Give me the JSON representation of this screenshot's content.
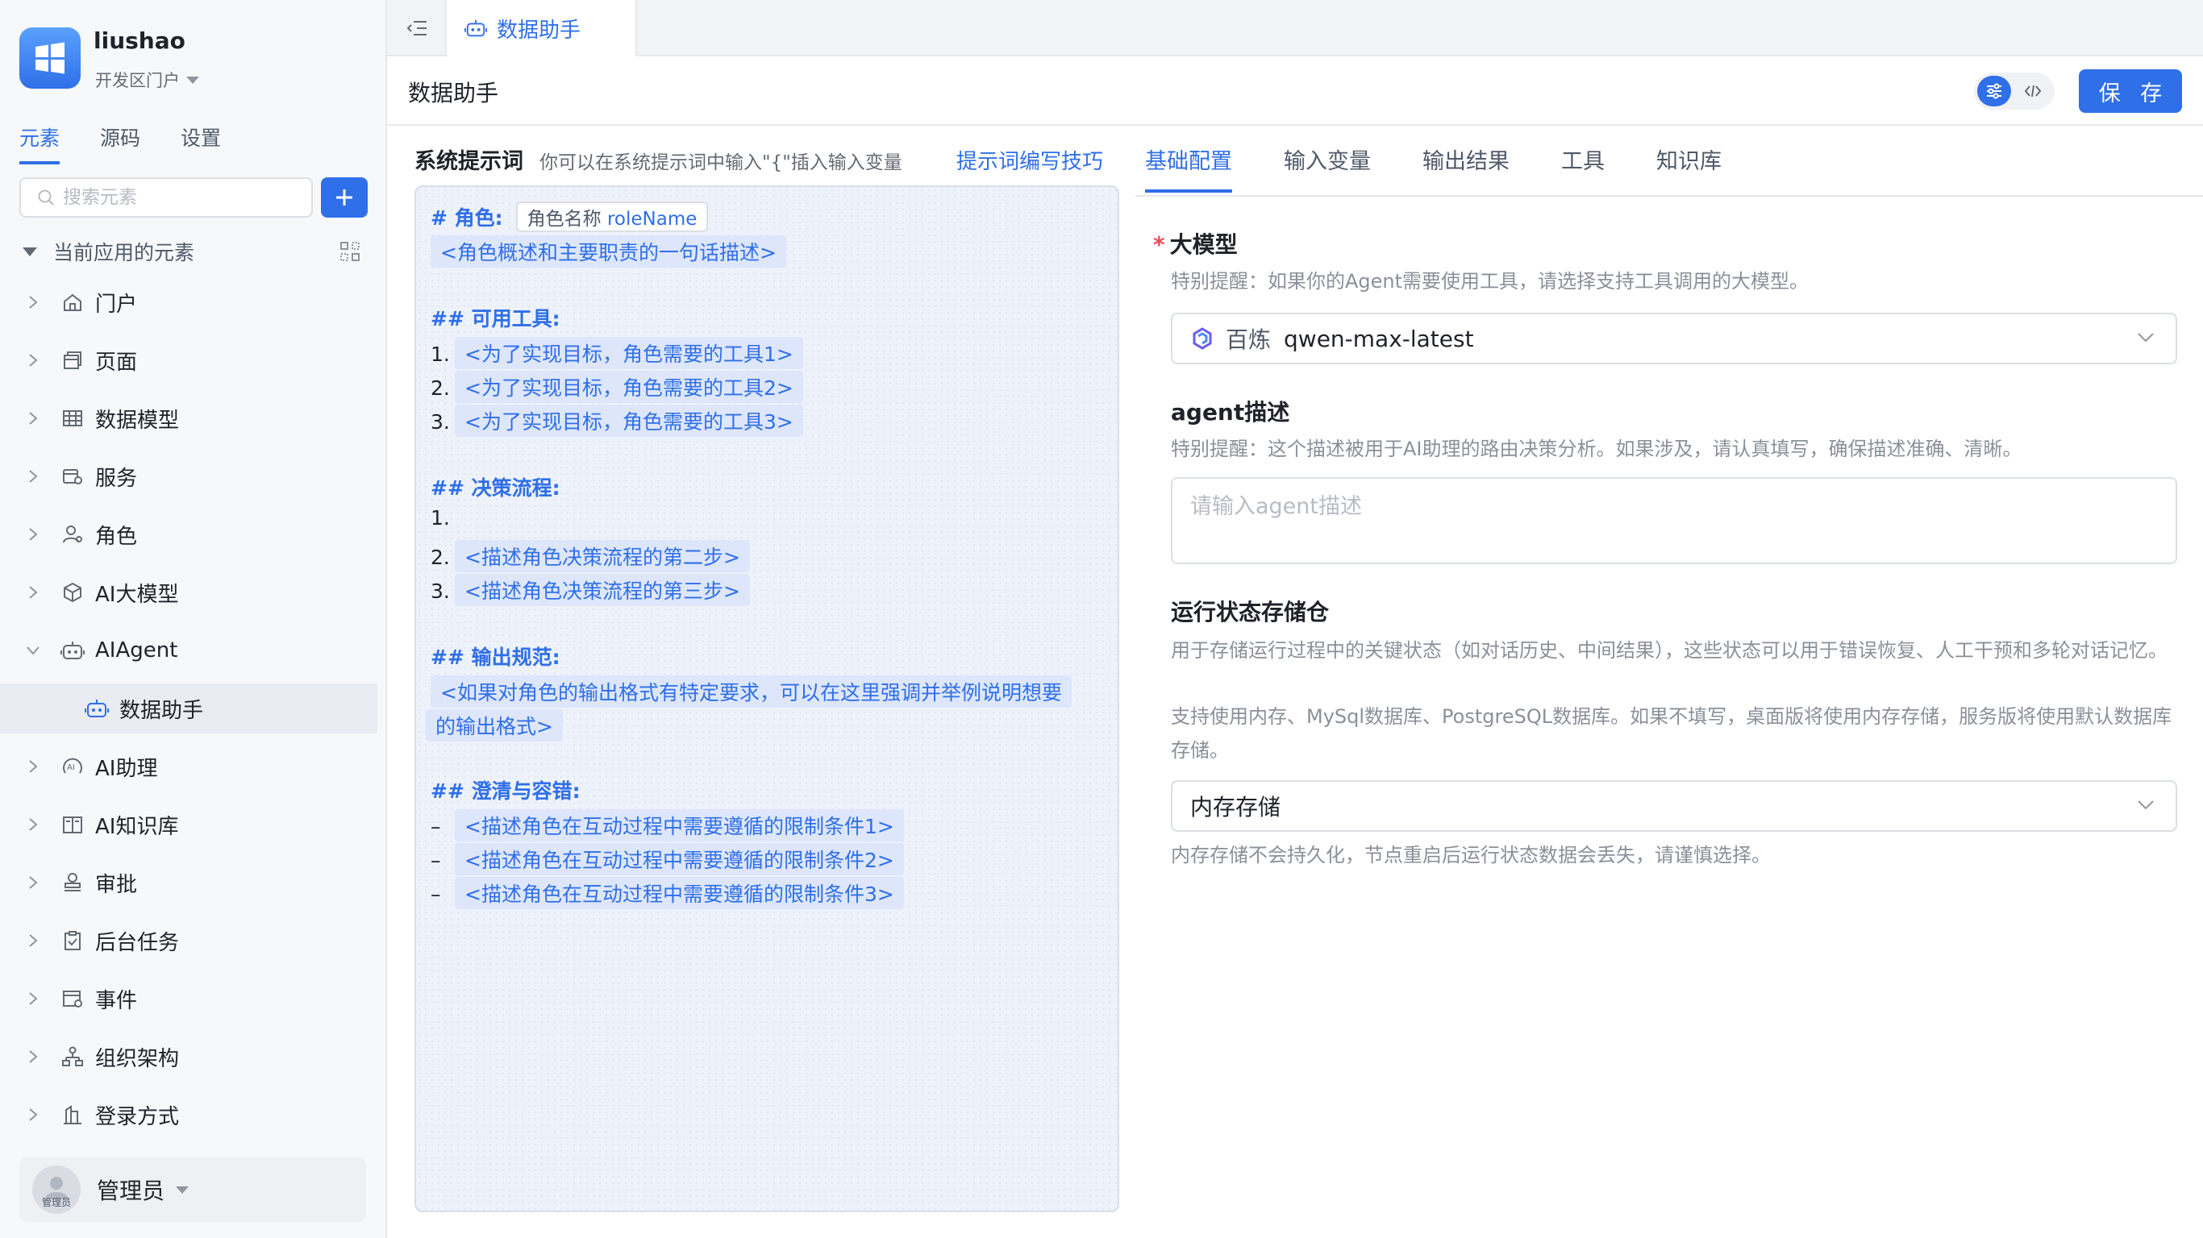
{
  "app": {
    "name": "liushao",
    "portal": "开发区门户"
  },
  "sidebar": {
    "tabs": [
      {
        "label": "元素"
      },
      {
        "label": "源码"
      },
      {
        "label": "设置"
      }
    ],
    "search_placeholder": "搜索元素",
    "section_title": "当前应用的元素",
    "items": [
      {
        "label": "门户",
        "icon": "home-icon"
      },
      {
        "label": "页面",
        "icon": "page-icon"
      },
      {
        "label": "数据模型",
        "icon": "table-icon"
      },
      {
        "label": "服务",
        "icon": "service-icon"
      },
      {
        "label": "角色",
        "icon": "role-icon"
      },
      {
        "label": "AI大模型",
        "icon": "cube-icon"
      },
      {
        "label": "AIAgent",
        "icon": "robot-icon"
      },
      {
        "label": "数据助手",
        "icon": "robot-icon"
      },
      {
        "label": "AI助理",
        "icon": "ai-assistant-icon"
      },
      {
        "label": "AI知识库",
        "icon": "book-icon"
      },
      {
        "label": "审批",
        "icon": "stamp-icon"
      },
      {
        "label": "后台任务",
        "icon": "task-icon"
      },
      {
        "label": "事件",
        "icon": "event-icon"
      },
      {
        "label": "组织架构",
        "icon": "org-icon"
      },
      {
        "label": "登录方式",
        "icon": "login-icon"
      }
    ],
    "user": {
      "name": "管理员",
      "avatar_label": "管理员"
    }
  },
  "tabbar": {
    "active_tab": "数据助手"
  },
  "header": {
    "title": "数据助手",
    "save_label": "保 存"
  },
  "prompt": {
    "title": "系统提示词",
    "hint": "你可以在系统提示词中输入\"{\"插入输入变量",
    "tips_link": "提示词编写技巧",
    "role_header": "# 角色:",
    "role_chip_label": "角色名称",
    "role_chip_var": "roleName",
    "role_desc": "<角色概述和主要职责的一句话描述>",
    "tools_header": "## 可用工具:",
    "tools": [
      {
        "num": "1.",
        "text": "<为了实现目标，角色需要的工具1>"
      },
      {
        "num": "2.",
        "text": "<为了实现目标，角色需要的工具2>"
      },
      {
        "num": "3.",
        "text": "<为了实现目标，角色需要的工具3>"
      }
    ],
    "flow_header": "## 决策流程:",
    "flow": [
      {
        "num": "1.",
        "text": ""
      },
      {
        "num": "2.",
        "text": "<描述角色决策流程的第二步>"
      },
      {
        "num": "3.",
        "text": "<描述角色决策流程的第三步>"
      }
    ],
    "output_header": "## 输出规范:",
    "output_line1": "<如果对角色的输出格式有特定要求，可以在这里强调并举例说明想要",
    "output_line2": "的输出格式>",
    "clarify_header": "## 澄清与容错:",
    "clarify": [
      {
        "num": "–",
        "text": "<描述角色在互动过程中需要遵循的限制条件1>"
      },
      {
        "num": "–",
        "text": "<描述角色在互动过程中需要遵循的限制条件2>"
      },
      {
        "num": "–",
        "text": "<描述角色在互动过程中需要遵循的限制条件3>"
      }
    ]
  },
  "config": {
    "tabs": [
      {
        "label": "基础配置"
      },
      {
        "label": "输入变量"
      },
      {
        "label": "输出结果"
      },
      {
        "label": "工具"
      },
      {
        "label": "知识库"
      }
    ],
    "model": {
      "label": "大模型",
      "required_mark": "*",
      "note": "特别提醒：如果你的Agent需要使用工具，请选择支持工具调用的大模型。",
      "provider": "百炼",
      "value": "qwen-max-latest"
    },
    "agent_desc": {
      "label": "agent描述",
      "note": "特别提醒：这个描述被用于AI助理的路由决策分析。如果涉及，请认真填写，确保描述准确、清晰。",
      "placeholder": "请输入agent描述"
    },
    "storage": {
      "label": "运行状态存储仓",
      "note1": "用于存储运行过程中的关键状态（如对话历史、中间结果），这些状态可以用于错误恢复、人工干预和多轮对话记忆。",
      "note2": "支持使用内存、MySql数据库、PostgreSQL数据库。如果不填写，桌面版将使用内存存储，服务版将使用默认数据库存储。",
      "value": "内存存储",
      "warning": "内存存储不会持久化，节点重启后运行状态数据会丢失，请谨慎选择。"
    }
  }
}
